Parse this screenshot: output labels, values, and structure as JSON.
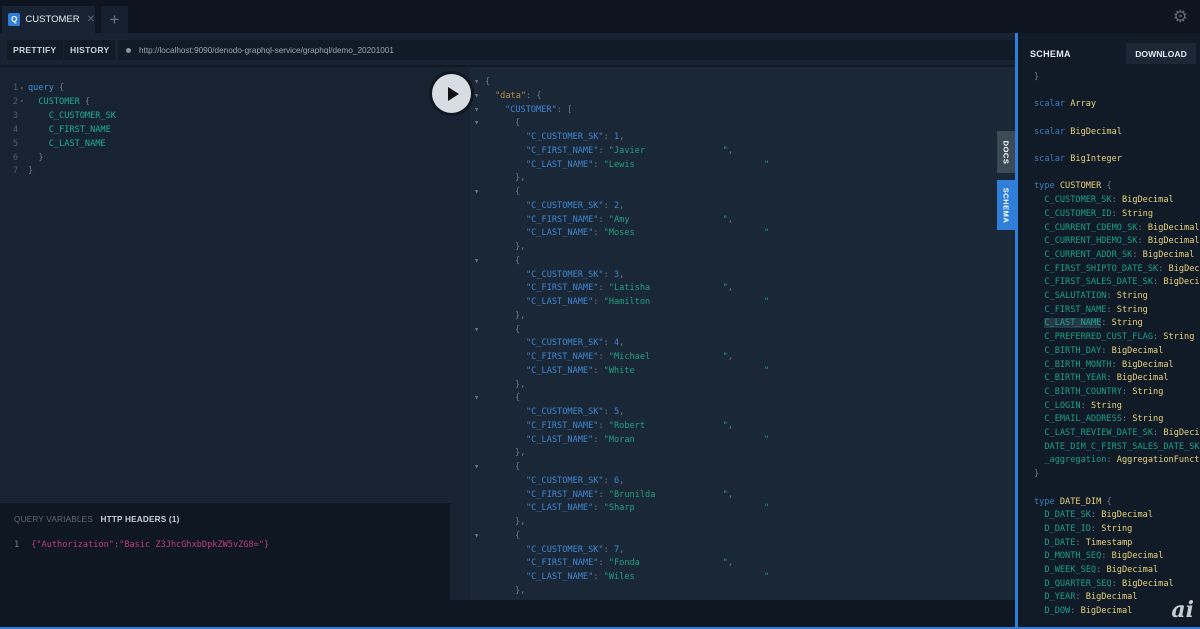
{
  "tabs": [
    {
      "badge": "Q",
      "label": "CUSTOMER"
    }
  ],
  "add_tab": "+",
  "toolbar": {
    "prettify": "PRETTIFY",
    "history": "HISTORY",
    "url": "http://localhost:9090/denodo-graphql-service/graphql/demo_20201001"
  },
  "query_lines": [
    {
      "n": "1",
      "fold": true,
      "parts": [
        [
          "kw",
          "query"
        ],
        [
          "br",
          " {"
        ]
      ]
    },
    {
      "n": "2",
      "fold": true,
      "parts": [
        [
          "fld",
          "  CUSTOMER"
        ],
        [
          "br",
          " {"
        ]
      ]
    },
    {
      "n": "3",
      "parts": [
        [
          "fld",
          "    C_CUSTOMER_SK"
        ]
      ]
    },
    {
      "n": "4",
      "parts": [
        [
          "fld",
          "    C_FIRST_NAME"
        ]
      ]
    },
    {
      "n": "5",
      "parts": [
        [
          "fld",
          "    C_LAST_NAME"
        ]
      ]
    },
    {
      "n": "6",
      "parts": [
        [
          "br",
          "  }"
        ]
      ]
    },
    {
      "n": "7",
      "parts": [
        [
          "br",
          "}"
        ]
      ]
    }
  ],
  "variables": {
    "tab_query_variables": "QUERY VARIABLES",
    "tab_http_headers": "HTTP HEADERS (1)",
    "line_number": "1",
    "content": "{\"Authorization\":\"Basic Z3JhcGhxbDpkZW5vZG8=\"}"
  },
  "result": {
    "root_key": "\"data\"",
    "list_key": "\"CUSTOMER\"",
    "records": [
      {
        "sk": "1",
        "first": "Javier",
        "last": "Lewis"
      },
      {
        "sk": "2",
        "first": "Amy",
        "last": "Moses"
      },
      {
        "sk": "3",
        "first": "Latisha",
        "last": "Hamilton"
      },
      {
        "sk": "4",
        "first": "Michael",
        "last": "White"
      },
      {
        "sk": "5",
        "first": "Robert",
        "last": "Moran"
      },
      {
        "sk": "6",
        "first": "Brunilda",
        "last": "Sharp"
      },
      {
        "sk": "7",
        "first": "Fonda",
        "last": "Wiles"
      }
    ],
    "field_sk": "\"C_CUSTOMER_SK\"",
    "field_first": "\"C_FIRST_NAME\"",
    "field_last": "\"C_LAST_NAME\""
  },
  "side_tabs": {
    "docs": "DOCS",
    "schema": "SCHEMA"
  },
  "schema": {
    "title": "SCHEMA",
    "download": "DOWNLOAD",
    "lines": [
      [
        [
          "sp",
          "}"
        ]
      ],
      [],
      [
        [
          "sk",
          "scalar "
        ],
        [
          "st",
          "Array"
        ]
      ],
      [],
      [
        [
          "sk",
          "scalar "
        ],
        [
          "st",
          "BigDecimal"
        ]
      ],
      [],
      [
        [
          "sk",
          "scalar "
        ],
        [
          "st",
          "BigInteger"
        ]
      ],
      [],
      [
        [
          "sk",
          "type "
        ],
        [
          "st",
          "CUSTOMER"
        ],
        [
          "sp",
          " {"
        ]
      ],
      [
        [
          "sf",
          "  C_CUSTOMER_SK"
        ],
        [
          "sp",
          ": "
        ],
        [
          "st",
          "BigDecimal"
        ]
      ],
      [
        [
          "sf",
          "  C_CUSTOMER_ID"
        ],
        [
          "sp",
          ": "
        ],
        [
          "st",
          "String"
        ]
      ],
      [
        [
          "sf",
          "  C_CURRENT_CDEMO_SK"
        ],
        [
          "sp",
          ": "
        ],
        [
          "st",
          "BigDecimal"
        ]
      ],
      [
        [
          "sf",
          "  C_CURRENT_HDEMO_SK"
        ],
        [
          "sp",
          ": "
        ],
        [
          "st",
          "BigDecimal"
        ]
      ],
      [
        [
          "sf",
          "  C_CURRENT_ADDR_SK"
        ],
        [
          "sp",
          ": "
        ],
        [
          "st",
          "BigDecimal"
        ]
      ],
      [
        [
          "sf",
          "  C_FIRST_SHIPTO_DATE_SK"
        ],
        [
          "sp",
          ": "
        ],
        [
          "st",
          "BigDecimal"
        ]
      ],
      [
        [
          "sf",
          "  C_FIRST_SALES_DATE_SK"
        ],
        [
          "sp",
          ": "
        ],
        [
          "st",
          "BigDecimal"
        ]
      ],
      [
        [
          "sf",
          "  C_SALUTATION"
        ],
        [
          "sp",
          ": "
        ],
        [
          "st",
          "String"
        ]
      ],
      [
        [
          "sf",
          "  C_FIRST_NAME"
        ],
        [
          "sp",
          ": "
        ],
        [
          "st",
          "String"
        ]
      ],
      [
        [
          "sf",
          "  "
        ],
        [
          "sf hl",
          "C_LAST_NAME"
        ],
        [
          "sp",
          ": "
        ],
        [
          "st",
          "String"
        ]
      ],
      [
        [
          "sf",
          "  C_PREFERRED_CUST_FLAG"
        ],
        [
          "sp",
          ": "
        ],
        [
          "st",
          "String"
        ]
      ],
      [
        [
          "sf",
          "  C_BIRTH_DAY"
        ],
        [
          "sp",
          ": "
        ],
        [
          "st",
          "BigDecimal"
        ]
      ],
      [
        [
          "sf",
          "  C_BIRTH_MONTH"
        ],
        [
          "sp",
          ": "
        ],
        [
          "st",
          "BigDecimal"
        ]
      ],
      [
        [
          "sf",
          "  C_BIRTH_YEAR"
        ],
        [
          "sp",
          ": "
        ],
        [
          "st",
          "BigDecimal"
        ]
      ],
      [
        [
          "sf",
          "  C_BIRTH_COUNTRY"
        ],
        [
          "sp",
          ": "
        ],
        [
          "st",
          "String"
        ]
      ],
      [
        [
          "sf",
          "  C_LOGIN"
        ],
        [
          "sp",
          ": "
        ],
        [
          "st",
          "String"
        ]
      ],
      [
        [
          "sf",
          "  C_EMAIL_ADDRESS"
        ],
        [
          "sp",
          ": "
        ],
        [
          "st",
          "String"
        ]
      ],
      [
        [
          "sf",
          "  C_LAST_REVIEW_DATE_SK"
        ],
        [
          "sp",
          ": "
        ],
        [
          "st",
          "BigDecimal"
        ]
      ],
      [
        [
          "sf",
          "  DATE_DIM_C_FIRST_SALES_DATE_SK"
        ]
      ],
      [
        [
          "sf",
          "  _aggregation"
        ],
        [
          "sp",
          ": "
        ],
        [
          "st",
          "AggregationFunctions"
        ]
      ],
      [
        [
          "sp",
          "}"
        ]
      ],
      [],
      [
        [
          "sk",
          "type "
        ],
        [
          "st",
          "DATE_DIM"
        ],
        [
          "sp",
          " {"
        ]
      ],
      [
        [
          "sf",
          "  D_DATE_SK"
        ],
        [
          "sp",
          ": "
        ],
        [
          "st",
          "BigDecimal"
        ]
      ],
      [
        [
          "sf",
          "  D_DATE_ID"
        ],
        [
          "sp",
          ": "
        ],
        [
          "st",
          "String"
        ]
      ],
      [
        [
          "sf",
          "  D_DATE"
        ],
        [
          "sp",
          ": "
        ],
        [
          "st",
          "Timestamp"
        ]
      ],
      [
        [
          "sf",
          "  D_MONTH_SEQ"
        ],
        [
          "sp",
          ": "
        ],
        [
          "st",
          "BigDecimal"
        ]
      ],
      [
        [
          "sf",
          "  D_WEEK_SEQ"
        ],
        [
          "sp",
          ": "
        ],
        [
          "st",
          "BigDecimal"
        ]
      ],
      [
        [
          "sf",
          "  D_QUARTER_SEQ"
        ],
        [
          "sp",
          ": "
        ],
        [
          "st",
          "BigDecimal"
        ]
      ],
      [
        [
          "sf",
          "  D_YEAR"
        ],
        [
          "sp",
          ": "
        ],
        [
          "st",
          "BigDecimal"
        ]
      ],
      [
        [
          "sf",
          "  D_DOW"
        ],
        [
          "sp",
          ": "
        ],
        [
          "st",
          "BigDecimal"
        ]
      ]
    ]
  },
  "watermark": "ai",
  "colors": {
    "accent": "#2f7fd8",
    "editor_bg": "#172333",
    "schema_bg": "#111b27"
  }
}
